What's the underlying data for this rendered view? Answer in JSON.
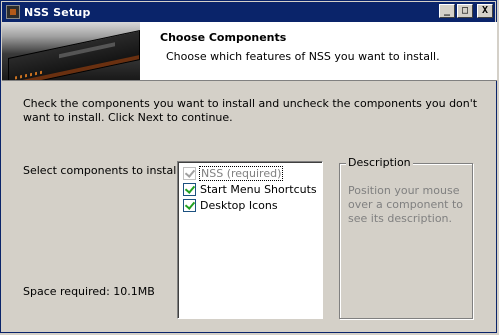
{
  "window": {
    "title": "NSS Setup",
    "buttons": {
      "minimize": "_",
      "maximize": "□",
      "close": "X"
    }
  },
  "header": {
    "title": "Choose Components",
    "subtitle": "Choose which features of NSS you want to install."
  },
  "body": {
    "intro": "Check the components you want to install and uncheck the components you don't want to install. Click Next to continue.",
    "select_label": "Select components to install:",
    "space_required": "Space required: 10.1MB"
  },
  "components": [
    {
      "label": "NSS (required)",
      "checked": true,
      "disabled": true
    },
    {
      "label": "Start Menu Shortcuts",
      "checked": true,
      "disabled": false
    },
    {
      "label": "Desktop Icons",
      "checked": true,
      "disabled": false
    }
  ],
  "description": {
    "legend": "Description",
    "text": "Position your mouse over a component to see its description."
  },
  "icons": {
    "title_icon": "nss-app-icon",
    "header_image": "product-box-image",
    "checkbox": "checkbox-checked-icon"
  },
  "colors": {
    "titlebar": "#0a246a",
    "face": "#d4d0c8",
    "check": "#21a121"
  }
}
